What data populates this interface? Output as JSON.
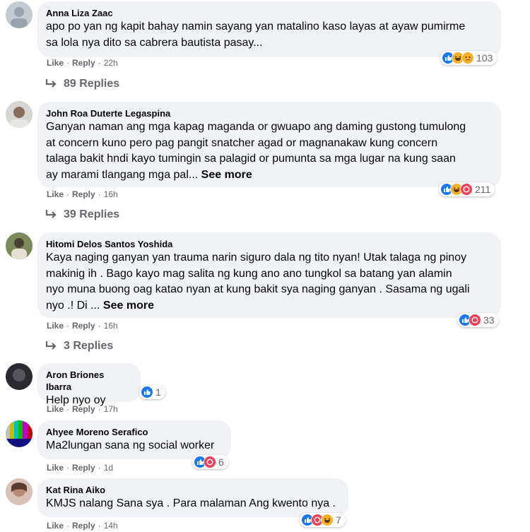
{
  "comments": [
    {
      "author": "Anna Liza Zaac",
      "lines": [
        "apo po yan ng kapit bahay namin sayang yan matalino kaso layas at ayaw pumirme",
        "sa lola nya dito sa cabrera bautista pasay..."
      ],
      "see_more": "",
      "reaction_count": "103",
      "like": "Like",
      "reply": "Reply",
      "time": "22h",
      "replies": "89 Replies"
    },
    {
      "author": "John Roa Duterte Legaspina",
      "lines": [
        "Ganyan naman ang mga kapag maganda or gwuapo ang daming gustong tumulong",
        "at concern kuno pero pag pangit snatcher agad or magnanakaw kung concern",
        "talaga bakit hndi kayo tumingin sa palagid or pumunta sa mga lugar na kung saan",
        "ay marami tlangang mga pal..."
      ],
      "see_more": "See more",
      "reaction_count": "211",
      "like": "Like",
      "reply": "Reply",
      "time": "16h",
      "replies": "39 Replies"
    },
    {
      "author": "Hitomi Delos Santos Yoshida",
      "lines": [
        "Kaya naging ganyan yan trauma narin siguro dala ng tito nyan! Utak talaga ng pinoy",
        "makinig ih . Bago kayo mag salita ng kung ano ano tungkol sa batang yan alamin",
        "nyo muna buong oag katao nyan at kung bakit sya naging ganyan . Sasama ng ugali",
        "nyo .! Di ..."
      ],
      "see_more": "See more",
      "reaction_count": "33",
      "like": "Like",
      "reply": "Reply",
      "time": "16h",
      "replies": "3 Replies"
    },
    {
      "author": "Aron Briones Ibarra",
      "lines": [
        "Help nyo oy"
      ],
      "see_more": "",
      "reaction_count": "1",
      "like": "Like",
      "reply": "Reply",
      "time": "17h",
      "replies": ""
    },
    {
      "author": "Ahyee Moreno Serafico",
      "lines": [
        "Ma2lungan sana ng social worker"
      ],
      "see_more": "",
      "reaction_count": "6",
      "like": "Like",
      "reply": "Reply",
      "time": "1d",
      "replies": ""
    },
    {
      "author": "Kat Rina Aiko",
      "lines": [
        "KMJS nalang Sana sya . Para malaman Ang kwento nya ."
      ],
      "see_more": "",
      "reaction_count": "7",
      "like": "Like",
      "reply": "Reply",
      "time": "14h",
      "replies": ""
    }
  ],
  "icons": {
    "like": "like-reaction-icon",
    "haha": "haha-reaction-icon",
    "sad": "sad-reaction-icon",
    "care": "care-reaction-icon",
    "reply_arrow": "reply-arrow-icon"
  },
  "colors": {
    "like_blue": "#1877f2",
    "haha_yellow": "#f7b125",
    "care_red": "#f33e58",
    "bubble_bg": "#f0f2f5",
    "secondary_text": "#65676b"
  }
}
